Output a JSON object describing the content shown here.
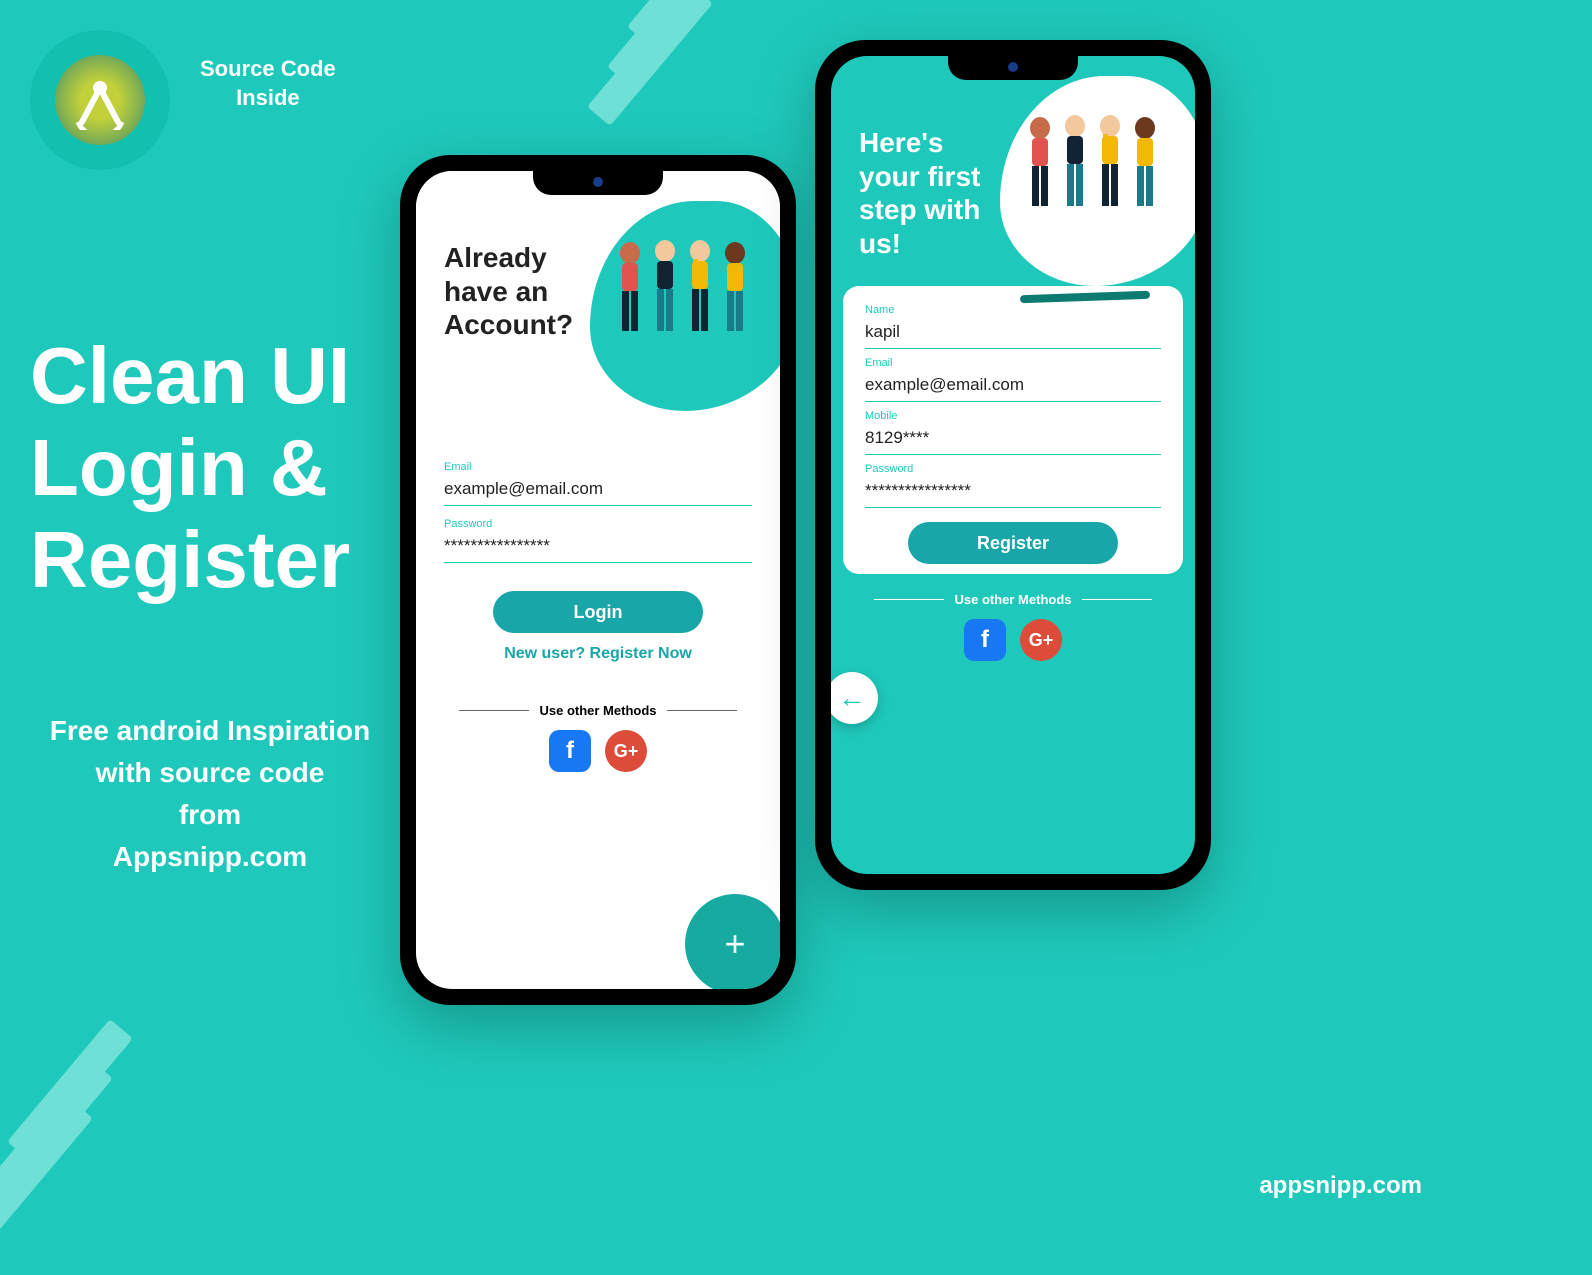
{
  "badge": {
    "label_line1": "Source Code",
    "label_line2": "Inside"
  },
  "title_line1": "Clean UI",
  "title_line2": "Login &",
  "title_line3": "Register",
  "subtitle_line1": "Free android Inspiration",
  "subtitle_line2": "with source code",
  "subtitle_line3": "from",
  "subtitle_line4": "Appsnipp.com",
  "footer_brand": "appsnipp.com",
  "login": {
    "hero_line1": "Already",
    "hero_line2": "have an",
    "hero_line3": "Account?",
    "email_label": "Email",
    "email_value": "example@email.com",
    "password_label": "Password",
    "password_value": "****************",
    "button_label": "Login",
    "register_link": "New user? Register Now",
    "other_methods_label": "Use other Methods"
  },
  "register": {
    "hero_line1": "Here's",
    "hero_line2": "your first",
    "hero_line3": "step with",
    "hero_line4": "us!",
    "name_label": "Name",
    "name_value": "kapil",
    "email_label": "Email",
    "email_value": "example@email.com",
    "mobile_label": "Mobile",
    "mobile_value": "8129****",
    "password_label": "Password",
    "password_value": "****************",
    "button_label": "Register",
    "other_methods_label": "Use other Methods"
  },
  "social": {
    "fb": "f",
    "gp": "G+"
  },
  "icons": {
    "plus": "+",
    "back": "←"
  }
}
